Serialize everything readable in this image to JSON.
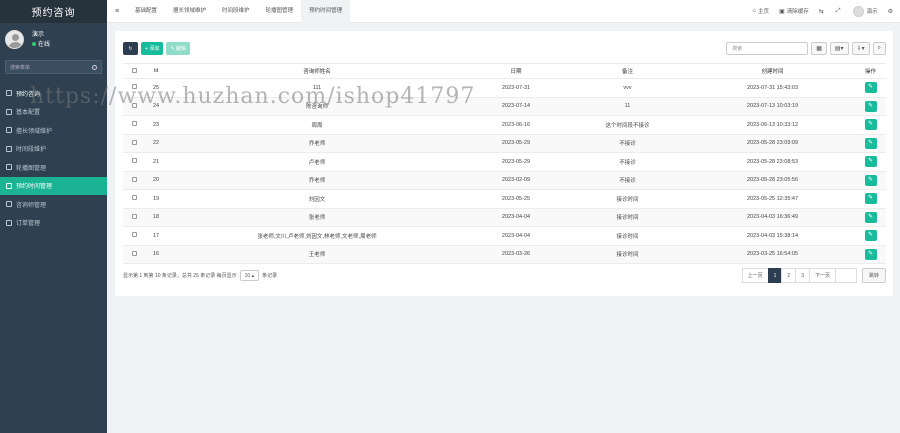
{
  "brand": "预约咨询",
  "user": {
    "name": "演示",
    "status": "在线"
  },
  "sidebar": {
    "search_placeholder": "搜索菜单",
    "items": [
      {
        "label": "预约咨询",
        "icon": "grid-icon"
      },
      {
        "label": "基本配置",
        "icon": "pin-icon"
      },
      {
        "label": "擅长领域维护",
        "icon": "list-icon"
      },
      {
        "label": "时间段维护",
        "icon": "list-icon"
      },
      {
        "label": "轮播图管理",
        "icon": "gear-icon"
      },
      {
        "label": "预约时间管理",
        "icon": "calendar-icon"
      },
      {
        "label": "咨询师管理",
        "icon": "list-icon"
      },
      {
        "label": "订单管理",
        "icon": "list-icon"
      }
    ]
  },
  "topbar": {
    "tabs": [
      "基础配置",
      "擅长领域维护",
      "时间段维护",
      "轮播图管理",
      "预约时间管理"
    ],
    "right": {
      "home": "主页",
      "clear_cache": "清除缓存",
      "user": "演示"
    }
  },
  "toolbar": {
    "add": "添加",
    "edit": "编辑",
    "search_placeholder": "搜索"
  },
  "table": {
    "headers": [
      "Id",
      "咨询师姓名",
      "日期",
      "备注",
      "创建时间",
      "操作"
    ],
    "rows": [
      {
        "id": "25",
        "name": "111",
        "date": "2023-07-31",
        "remark": "vvv",
        "created": "2023-07-31 15:43:03"
      },
      {
        "id": "24",
        "name": "陈咨询师",
        "date": "2023-07-14",
        "remark": "11",
        "created": "2023-07-13 10:03:19"
      },
      {
        "id": "23",
        "name": "周周",
        "date": "2023-06-16",
        "remark": "这个时间段不接诊",
        "created": "2023-06-13 10:33:12"
      },
      {
        "id": "22",
        "name": "乔老师",
        "date": "2023-05-29",
        "remark": "不接诊",
        "created": "2023-05-28 23:09:09"
      },
      {
        "id": "21",
        "name": "卢老师",
        "date": "2023-05-29",
        "remark": "不接诊",
        "created": "2023-05-28 23:08:53"
      },
      {
        "id": "20",
        "name": "乔老师",
        "date": "2023-02-09",
        "remark": "不接诊",
        "created": "2023-05-28 23:05:56"
      },
      {
        "id": "19",
        "name": "刘因文",
        "date": "2023-05-25",
        "remark": "接诊时间",
        "created": "2023-05-25 12:35:47"
      },
      {
        "id": "18",
        "name": "张老师",
        "date": "2023-04-04",
        "remark": "接诊时间",
        "created": "2023-04-03 16:36:49"
      },
      {
        "id": "17",
        "name": "张老师,文川,卢老师,刘因文,林老师,文老师,周老师",
        "date": "2023-04-04",
        "remark": "接诊时间",
        "created": "2023-04-03 15:38:14"
      },
      {
        "id": "16",
        "name": "王老师",
        "date": "2023-03-26",
        "remark": "接诊时间",
        "created": "2023-03-25 16:54:05"
      }
    ]
  },
  "pagination": {
    "info_prefix": "显示第 1 到第 10 条记录，总共 25 条记录 每页显示",
    "page_size": "10",
    "info_suffix": "条记录",
    "prev": "上一页",
    "pages": [
      "1",
      "2",
      "3"
    ],
    "next": "下一页",
    "jump": "跳转"
  },
  "watermark": "https://www.huzhan.com/ishop41797"
}
